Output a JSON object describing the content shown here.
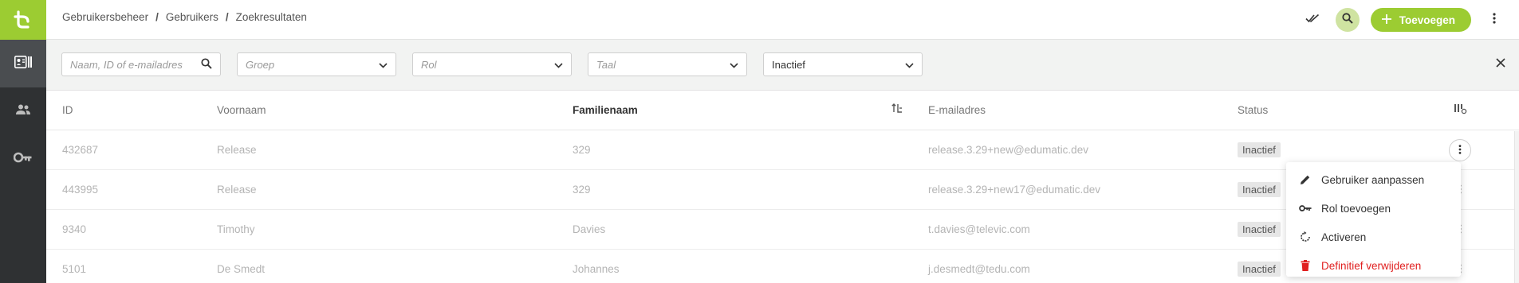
{
  "app": {
    "logo_icon": "edumatic-logo-icon",
    "accent_color": "#9ccc32",
    "danger_color": "#e02020"
  },
  "sidebar": {
    "items": [
      {
        "name": "user-card-icon",
        "active": true
      },
      {
        "name": "groups-icon",
        "active": false
      },
      {
        "name": "key-icon",
        "active": false
      }
    ]
  },
  "breadcrumb": [
    "Gebruikersbeheer",
    "Gebruikers",
    "Zoekresultaten"
  ],
  "breadcrumb_separator": "/",
  "header": {
    "add_label": "Toevoegen"
  },
  "filters": {
    "search_placeholder": "Naam, ID of e-mailadres",
    "group_placeholder": "Groep",
    "role_placeholder": "Rol",
    "language_placeholder": "Taal",
    "status_value": "Inactief"
  },
  "table": {
    "columns": {
      "id": "ID",
      "firstname": "Voornaam",
      "lastname": "Familienaam",
      "email": "E-mailadres",
      "status": "Status"
    },
    "rows": [
      {
        "id": "432687",
        "firstname": "Release",
        "lastname": "329",
        "email": "release.3.29+new@edumatic.dev",
        "status": "Inactief"
      },
      {
        "id": "443995",
        "firstname": "Release",
        "lastname": "329",
        "email": "release.3.29+new17@edumatic.dev",
        "status": "Inactief"
      },
      {
        "id": "9340",
        "firstname": "Timothy",
        "lastname": "Davies",
        "email": "t.davies@televic.com",
        "status": "Inactief"
      },
      {
        "id": "5101",
        "firstname": "De Smedt",
        "lastname": "Johannes",
        "email": "j.desmedt@tedu.com",
        "status": "Inactief"
      }
    ]
  },
  "row_menu": {
    "items": [
      {
        "label": "Gebruiker aanpassen",
        "icon": "pencil-icon"
      },
      {
        "label": "Rol toevoegen",
        "icon": "key-icon"
      },
      {
        "label": "Activeren",
        "icon": "refresh-icon"
      },
      {
        "label": "Definitief verwijderen",
        "icon": "trash-icon"
      }
    ]
  }
}
